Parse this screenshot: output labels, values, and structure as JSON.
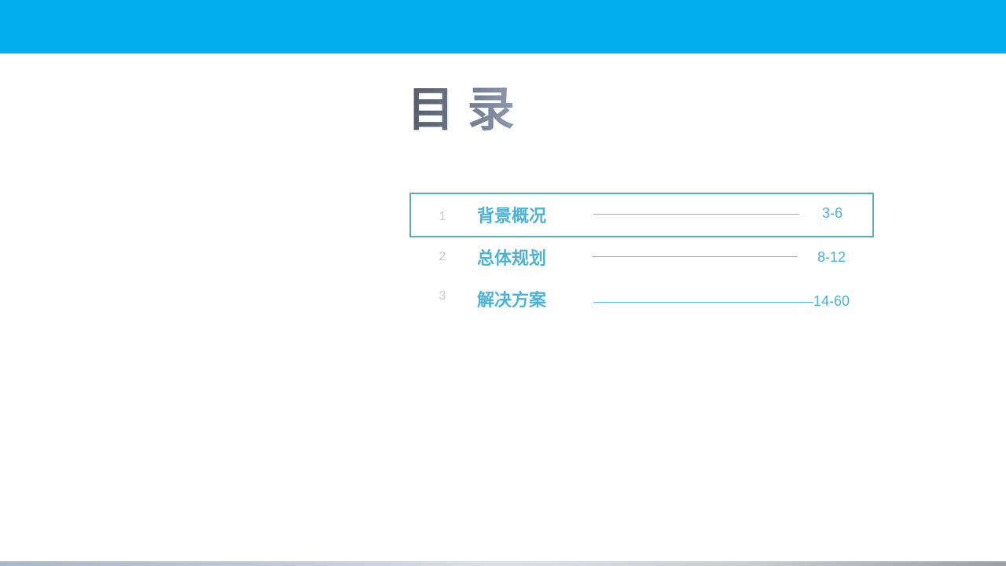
{
  "title": "目 录",
  "toc": {
    "items": [
      {
        "number": "1",
        "label": "背景概况",
        "pages": "3-6",
        "active": true
      },
      {
        "number": "2",
        "label": "总体规划",
        "pages": "8-12",
        "active": false
      },
      {
        "number": "3",
        "label": "解决方案",
        "pages": "14-60",
        "active": false
      }
    ]
  },
  "colors": {
    "header_bar": "#00AEEF",
    "accent_text": "#4DB3D4",
    "active_border": "#5AAEBC",
    "number_text": "#C8C8C8",
    "leader_gray": "#A6A6A6",
    "leader_blue": "#5AB4D8"
  }
}
